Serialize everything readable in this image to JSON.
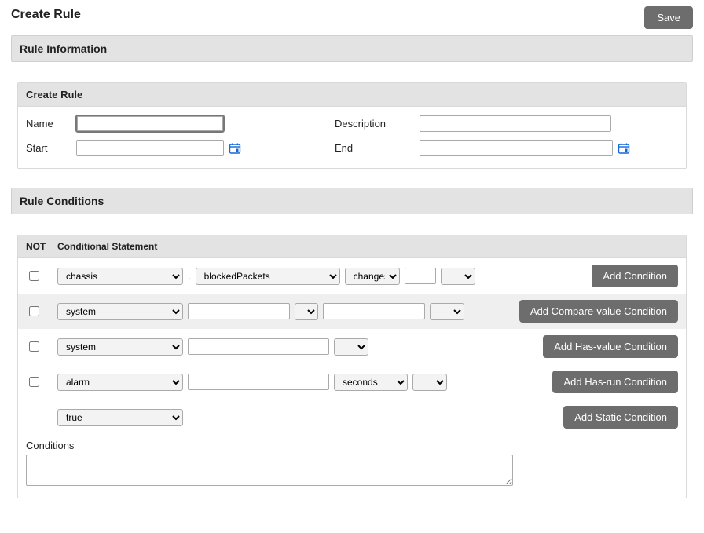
{
  "page": {
    "title": "Create Rule",
    "save": "Save"
  },
  "sections": {
    "ruleInfo": "Rule Information",
    "ruleConditions": "Rule Conditions"
  },
  "rulePanel": {
    "header": "Create Rule",
    "labels": {
      "name": "Name",
      "description": "Description",
      "start": "Start",
      "end": "End"
    },
    "values": {
      "name": "",
      "description": "",
      "start": "",
      "end": ""
    }
  },
  "condHead": {
    "not": "NOT",
    "stmt": "Conditional Statement"
  },
  "rows": {
    "r1": {
      "sel1": "chassis",
      "sel2": "blockedPackets",
      "sel3": "changes",
      "txt": "",
      "sel4": "",
      "btn": "Add Condition"
    },
    "r2": {
      "sel1": "system",
      "txt1": "",
      "op": "=",
      "txt2": "",
      "sel2": "",
      "btn": "Add Compare-value Condition"
    },
    "r3": {
      "sel1": "system",
      "txt1": "",
      "sel2": "",
      "btn": "Add Has-value Condition"
    },
    "r4": {
      "sel1": "alarm",
      "txt1": "",
      "sel2": "seconds",
      "sel3": "",
      "btn": "Add Has-run Condition"
    },
    "r5": {
      "sel1": "true",
      "btn": "Add Static Condition"
    }
  },
  "conditionsLabel": "Conditions",
  "conditionsText": ""
}
